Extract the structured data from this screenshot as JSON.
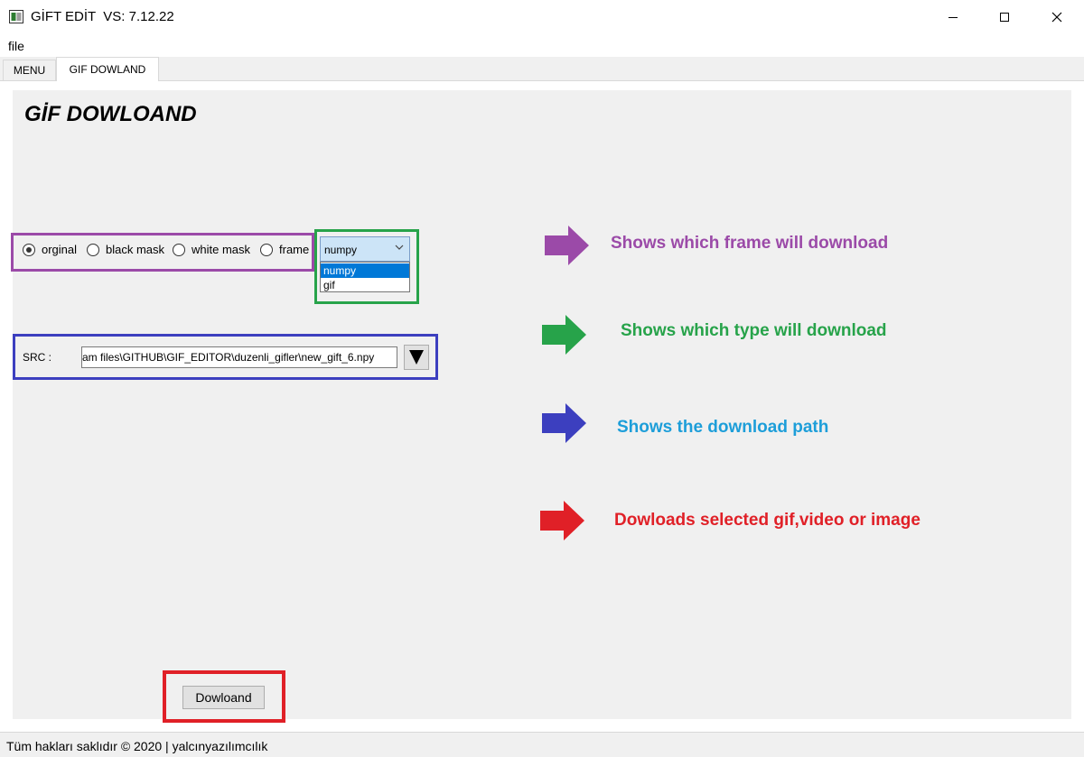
{
  "window": {
    "title": "GİFT EDİT  VS: 7.12.22",
    "minimize_icon": "minimize-icon",
    "maximize_icon": "maximize-icon",
    "close_icon": "close-icon"
  },
  "menubar": {
    "file_label": "file"
  },
  "tabs": [
    {
      "label": "MENU",
      "selected": false
    },
    {
      "label": "GIF DOWLAND",
      "selected": true
    }
  ],
  "page": {
    "heading": "GİF DOWLOAND",
    "frame_options": [
      {
        "label": "orginal",
        "checked": true
      },
      {
        "label": "black mask",
        "checked": false
      },
      {
        "label": "white mask",
        "checked": false
      },
      {
        "label": "frame",
        "checked": false
      }
    ],
    "type_select": {
      "value": "numpy",
      "options": [
        "numpy",
        "gif"
      ],
      "highlighted": "numpy"
    },
    "src": {
      "label": "SRC :",
      "value": "am files\\GITHUB\\GIF_EDITOR\\duzenli_gifler\\new_gift_6.npy",
      "browse_icon": "triangle-down-icon"
    },
    "download_button": "Dowloand"
  },
  "annotations": [
    {
      "text": "Shows which frame will download",
      "color": "#9b4aa8"
    },
    {
      "text": "Shows which type will download",
      "color": "#27a34a"
    },
    {
      "text": "Shows the download path",
      "color": "#1d9ed9",
      "arrow_color": "#3c3fbf"
    },
    {
      "text": "Dowloads selected gif,video or image",
      "color": "#e02027"
    }
  ],
  "statusbar": {
    "text": "Tüm hakları saklıdır © 2020 | yalcınyazılımcılık"
  },
  "colors": {
    "frame_highlight": "#9b4aa8",
    "type_highlight": "#27a34a",
    "path_highlight": "#3c3fbf",
    "download_highlight": "#e02027",
    "selection": "#0078d7"
  }
}
